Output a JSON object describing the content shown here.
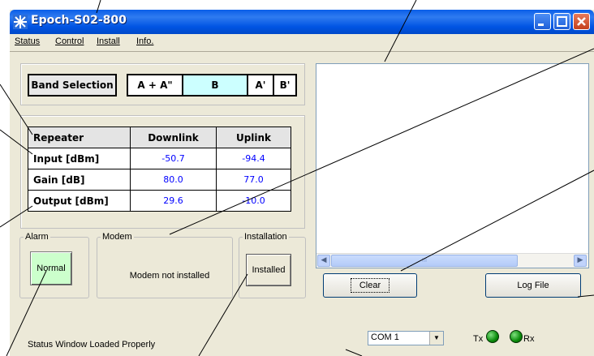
{
  "window": {
    "title": "Epoch-S02-800"
  },
  "menu": {
    "items": [
      "Status",
      "Control",
      "Install",
      "Info."
    ]
  },
  "band_selection": {
    "label": "Band Selection",
    "options": [
      "A + A\"",
      "B",
      "A'",
      "B'"
    ],
    "selected": "B"
  },
  "table": {
    "headers": [
      "Repeater",
      "Downlink",
      "Uplink"
    ],
    "rows": [
      {
        "label": "Input [dBm]",
        "downlink": "-50.7",
        "uplink": "-94.4"
      },
      {
        "label": "Gain [dB]",
        "downlink": "80.0",
        "uplink": "77.0"
      },
      {
        "label": "Output [dBm]",
        "downlink": "29.6",
        "uplink": "-10.0"
      }
    ]
  },
  "alarm": {
    "legend": "Alarm",
    "button": "Normal"
  },
  "modem": {
    "legend": "Modem",
    "text": "Modem not installed"
  },
  "installation": {
    "legend": "Installation",
    "button": "Installed"
  },
  "log": {
    "clear": "Clear",
    "log_file": "Log File",
    "scroll_grip": "III"
  },
  "status": {
    "text": "Status Window Loaded Properly",
    "com": "COM 1",
    "tx": "Tx",
    "rx": "Rx"
  },
  "colors": {
    "accent_selected": "#ccffff",
    "alarm_normal": "#ccffcc",
    "value_text": "#0000ff",
    "led": "#0a8a0a"
  }
}
